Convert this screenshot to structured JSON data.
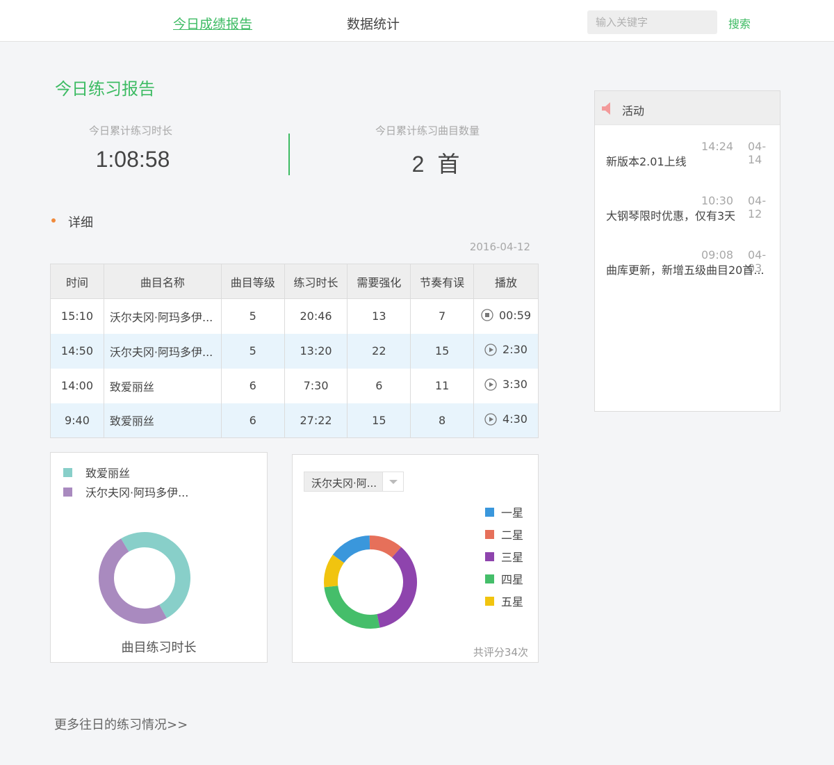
{
  "nav": {
    "tabs": [
      {
        "label": "今日成绩报告",
        "active": true
      },
      {
        "label": "数据统计",
        "active": false
      }
    ],
    "search": {
      "placeholder": "输入关键字",
      "value": "",
      "button_label": "搜索"
    }
  },
  "report": {
    "title": "今日练习报告",
    "duration_label": "今日累计练习时长",
    "duration_value": "1:08:58",
    "count_label": "今日累计练习曲目数量",
    "count_value": "2 首",
    "detail_label": "详细",
    "date": "2016-04-12"
  },
  "table": {
    "headers": [
      "时间",
      "曲目名称",
      "曲目等级",
      "练习时长",
      "需要强化",
      "节奏有误",
      "播放"
    ],
    "rows": [
      {
        "time": "15:10",
        "name": "沃尔夫冈·阿玛多伊...",
        "level": "5",
        "duration": "20:46",
        "reinforce": "13",
        "rhythm": "7",
        "play": "00:59",
        "state": "stop",
        "alt": false
      },
      {
        "time": "14:50",
        "name": "沃尔夫冈·阿玛多伊...",
        "level": "5",
        "duration": "13:20",
        "reinforce": "22",
        "rhythm": "15",
        "play": "2:30",
        "state": "play",
        "alt": true
      },
      {
        "time": "14:00",
        "name": "致爱丽丝",
        "level": "6",
        "duration": "7:30",
        "reinforce": "6",
        "rhythm": "11",
        "play": "3:30",
        "state": "play",
        "alt": false
      },
      {
        "time": "9:40",
        "name": "致爱丽丝",
        "level": "6",
        "duration": "27:22",
        "reinforce": "15",
        "rhythm": "8",
        "play": "4:30",
        "state": "play",
        "alt": true
      }
    ]
  },
  "chart_data": [
    {
      "type": "pie",
      "title": "曲目练习时长",
      "categories": [
        "致爱丽丝",
        "沃尔夫冈·阿玛多伊..."
      ],
      "values": [
        34.9,
        34.1
      ],
      "colors": [
        "#88cfc9",
        "#a98abf"
      ],
      "donut": true
    },
    {
      "type": "pie",
      "selected_piece": "沃尔夫冈·阿...",
      "categories": [
        "一星",
        "二星",
        "三星",
        "四星",
        "五星"
      ],
      "values": [
        5,
        4,
        12,
        9,
        4
      ],
      "colors": [
        "#3a97dc",
        "#e6705a",
        "#8e44ad",
        "#45be6a",
        "#f1c40f"
      ],
      "donut": true,
      "note": "共评分34次"
    }
  ],
  "activity": {
    "title": "活动",
    "icon": "speaker-icon",
    "items": [
      {
        "time": "14:24",
        "date": "04-14",
        "text": "新版本2.01上线"
      },
      {
        "time": "10:30",
        "date": "04-12",
        "text": "大钢琴限时优惠，仅有3天"
      },
      {
        "time": "09:08",
        "date": "04-03",
        "text": "曲库更新，新增五级曲目20首..."
      }
    ]
  },
  "footer": {
    "more_link": "更多往日的练习情况>>"
  }
}
